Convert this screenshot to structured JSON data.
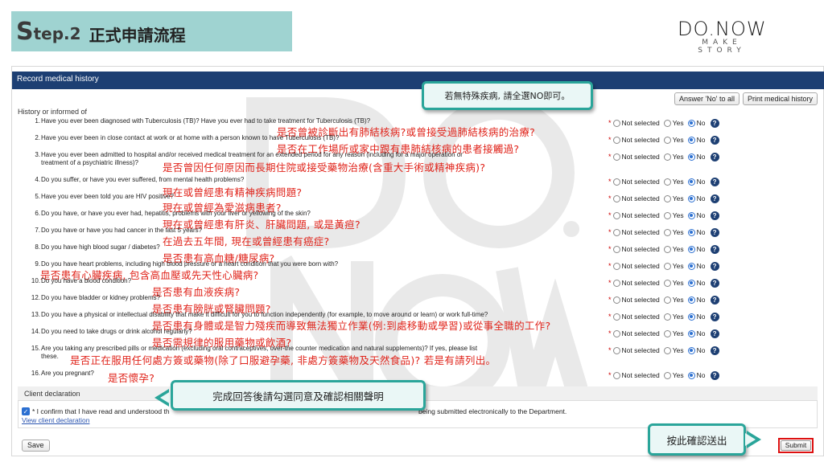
{
  "banner": {
    "step_big": "S",
    "step_rest": "tep.2",
    "title": "正式申請流程"
  },
  "logo": {
    "main": "DO.NOW",
    "sub": "MAKE STORY"
  },
  "form": {
    "header_title": "Record medical history",
    "answer_no_label": "Answer 'No' to all",
    "print_label": "Print medical history",
    "section_label": "History or informed of",
    "radio_labels": {
      "not_selected": "Not selected",
      "yes": "Yes",
      "no": "No"
    },
    "help_glyph": "?",
    "required_mark": "*",
    "questions": [
      {
        "num": "1.",
        "text": "Have you ever been diagnosed with Tuberculosis (TB)? Have you ever had to take treatment for Tuberculosis (TB)?",
        "text2": "",
        "note": "是否曾被診斷出有肺結核病?或曾接受過肺結核病的治療?",
        "selected": "No"
      },
      {
        "num": "2.",
        "text": "Have you ever been in close contact at work or at home with a person known to have Tuberculosis (TB)?",
        "text2": "",
        "note": "是否在工作場所或家中跟有患肺結核病的患者接觸過?",
        "selected": "No"
      },
      {
        "num": "3.",
        "text": "Have you ever been admitted to hospital and/or received medical treatment for an extended period for any reason (including for a major operation or",
        "text2": "treatment of a psychiatric illness)?",
        "note": "是否曾因任何原因而長期住院或接受藥物治療(含重大手術或精神疾病)?",
        "selected": "No"
      },
      {
        "num": "4.",
        "text": "Do you suffer, or have you ever suffered, from mental health problems?",
        "text2": "",
        "note": "現在或曾經患有精神疾病問題?",
        "selected": "No"
      },
      {
        "num": "5.",
        "text": "Have you ever been told you are HIV positive?",
        "text2": "",
        "note": "現在或曾經為愛滋病患者?",
        "selected": "No"
      },
      {
        "num": "6.",
        "text": "Do you have, or have you ever had, hepatitis, problems with your liver or yellowing of the skin?",
        "text2": "",
        "note": "現在或曾經患有肝炎、肝臟問題, 或是黃疸?",
        "selected": "No"
      },
      {
        "num": "7.",
        "text": "Do you have or have you had cancer in the last 5 years?",
        "text2": "",
        "note": "在過去五年間, 現在或曾經患有癌症?",
        "selected": "No"
      },
      {
        "num": "8.",
        "text": "Do you have high blood sugar / diabetes?",
        "text2": "",
        "note": "是否患有高血糖/糖尿病?",
        "selected": "No"
      },
      {
        "num": "9.",
        "text": "Do you have heart problems, including high blood pressure or a heart condition that you were born with?",
        "text2": "",
        "note": "是否患有心臟疾病, 包含高血壓或先天性心臟病?",
        "selected": "No"
      },
      {
        "num": "10.",
        "text": "Do you have a blood condition?",
        "text2": "",
        "note": "是否患有血液疾病?",
        "selected": "No"
      },
      {
        "num": "12.",
        "text": "Do you have bladder or kidney problems?",
        "text2": "",
        "note": "是否患有膀胱或腎臟問題?",
        "selected": "No"
      },
      {
        "num": "13.",
        "text": "Do you have a physical or intellectual disability that make it difficult for you to function independently (for example, to move around or learn) or work full-time?",
        "text2": "",
        "note": "是否患有身體或是智力殘疾而導致無法獨立作業(例:到處移動或學習)或從事全職的工作?",
        "selected": "No"
      },
      {
        "num": "14.",
        "text": "Do you need to take drugs or drink alcohol regularly?",
        "text2": "",
        "note": "是否需規律的服用藥物或飲酒?",
        "selected": "No"
      },
      {
        "num": "15.",
        "text": "Are you taking any prescribed pills or medication (excluding oral contraceptives, over-the counter medication and natural supplements)? If yes, please list",
        "text2": "these.",
        "note": "是否正在服用任何處方簽或藥物(除了口服避孕藥, 非處方簽藥物及天然食品)? 若是有請列出。",
        "selected": "No"
      },
      {
        "num": "16.",
        "text": "Are you pregnant?",
        "text2": "",
        "note": "是否懷孕?",
        "selected": "No"
      }
    ],
    "declaration": {
      "head": "Client declaration",
      "check_glyph": "✓",
      "text_left": "* I confirm that I have read and understood th",
      "text_right": "being submitted electronically to the Department.",
      "link": "View client declaration"
    },
    "save_label": "Save",
    "submit_label": "Submit"
  },
  "callouts": {
    "select_no": "若無特殊疾病, 請全選NO即可。",
    "declaration": "完成回答後請勾選同意及確認相關聲明",
    "submit": "按此確認送出"
  },
  "colors": {
    "accent": "#2aa59a",
    "header": "#1d3f73",
    "annotation": "#e0241b",
    "banner": "#9fd3d1"
  }
}
